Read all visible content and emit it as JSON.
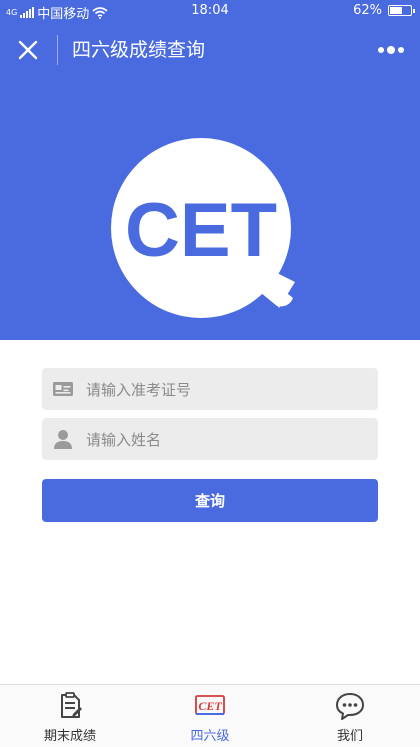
{
  "status_bar": {
    "signal_badge": "4G",
    "carrier": "中国移动",
    "time": "18:04",
    "battery_percent": "62%",
    "battery_level": 0.62
  },
  "nav": {
    "title": "四六级成绩查询",
    "close_icon": "close-icon",
    "more_icon": "more-dots-icon"
  },
  "hero": {
    "logo_text": "CET",
    "background": "#4a6be0"
  },
  "form": {
    "ticket_placeholder": "请输入准考证号",
    "name_placeholder": "请输入姓名",
    "ticket_value": "",
    "name_value": "",
    "submit_label": "查询"
  },
  "tabs": [
    {
      "label": "期末成绩",
      "icon": "report-icon",
      "active": false
    },
    {
      "label": "四六级",
      "icon": "cet-icon",
      "icon_text": "CET",
      "active": true
    },
    {
      "label": "我们",
      "icon": "chat-bubble-icon",
      "active": false
    }
  ],
  "colors": {
    "accent": "#4a6be0",
    "input_bg": "#ececec",
    "cet_icon_red": "#d23a3a"
  }
}
